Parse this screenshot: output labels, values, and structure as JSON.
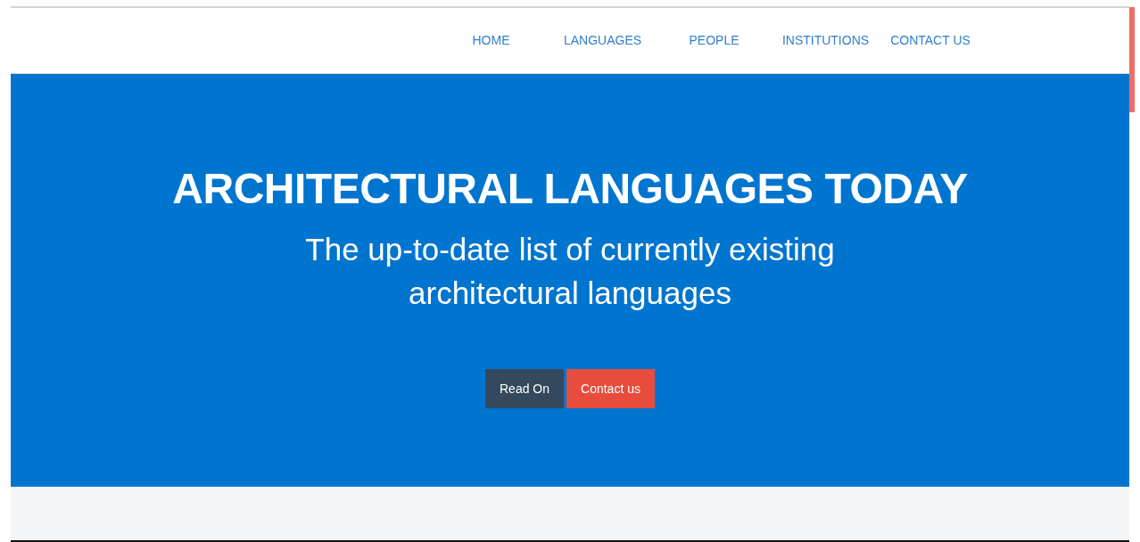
{
  "nav": {
    "items": [
      {
        "label": "HOME"
      },
      {
        "label": "LANGUAGES"
      },
      {
        "label": "PEOPLE"
      },
      {
        "label": "INSTITUTIONS"
      },
      {
        "label": "CONTACT US"
      }
    ]
  },
  "hero": {
    "title": "ARCHITECTURAL LANGUAGES TODAY",
    "subtitle_lines": [
      "The up-to-date list of currently existing",
      "architectural languages"
    ],
    "buttons": [
      {
        "label": "Read On",
        "kind": "dark"
      },
      {
        "label": "Contact us",
        "kind": "accent"
      }
    ]
  }
}
